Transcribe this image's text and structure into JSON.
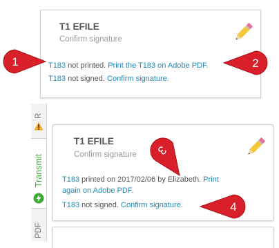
{
  "card_top": {
    "title": "T1 EFILE",
    "subtitle": "Confirm signature",
    "print_line": {
      "doc_link": "T183",
      "status": " not printed. ",
      "action_link": "Print the T183 on Adobe PDF."
    },
    "sign_line": {
      "doc_link": "T183",
      "status": " not signed. ",
      "action_link": "Confirm signature."
    }
  },
  "card_bottom": {
    "title": "T1 EFILE",
    "subtitle": "Confirm signature",
    "print_line": {
      "doc_link": "T183",
      "status": " printed on 2017/02/06 by Elizabeth. ",
      "action_link_part1": "Print",
      "action_link_part2": "again on Adobe PDF."
    },
    "sign_line": {
      "doc_link": "T183",
      "status": " not signed. ",
      "action_link": "Confirm signature."
    }
  },
  "side_tabs": {
    "review_fragment": "R",
    "transmit": "Transmit",
    "pdf_fragment": "PDF"
  },
  "callouts": [
    "1",
    "2",
    "3",
    "4"
  ],
  "colors": {
    "link": "#1b8ab8",
    "callout_red": "#d9202a",
    "warning_orange": "#f5a623",
    "transmit_green": "#3aaa35"
  },
  "icons": [
    "edit-pencil-icon",
    "warning-icon",
    "transmit-icon"
  ]
}
